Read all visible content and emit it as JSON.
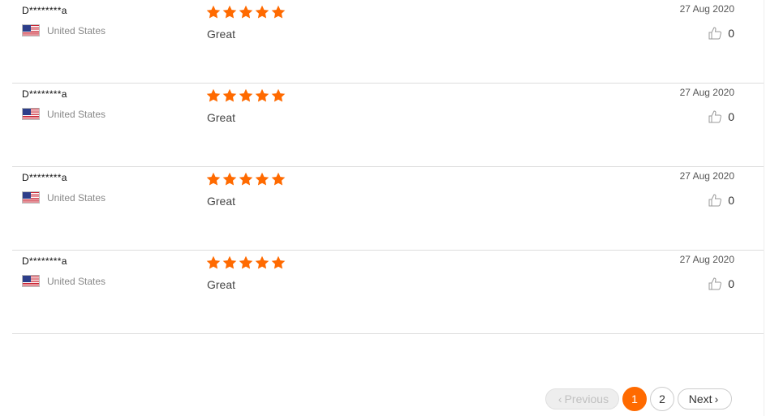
{
  "reviews": [
    {
      "user": "D********a",
      "country": "United States",
      "rating": 5,
      "comment": "Great",
      "date": "27 Aug 2020",
      "helpful_count": "0"
    },
    {
      "user": "D********a",
      "country": "United States",
      "rating": 5,
      "comment": "Great",
      "date": "27 Aug 2020",
      "helpful_count": "0"
    },
    {
      "user": "D********a",
      "country": "United States",
      "rating": 5,
      "comment": "Great",
      "date": "27 Aug 2020",
      "helpful_count": "0"
    },
    {
      "user": "D********a",
      "country": "United States",
      "rating": 5,
      "comment": "Great",
      "date": "27 Aug 2020",
      "helpful_count": "0"
    }
  ],
  "pagination": {
    "previous_label": "Previous",
    "pages": [
      "1",
      "2"
    ],
    "active_page": "1",
    "next_label": "Next"
  },
  "colors": {
    "star": "#ff6a00",
    "active_page": "#ff6a00",
    "divider": "#dddddd"
  },
  "icons": {
    "star": "star-icon",
    "flag": "us-flag-icon",
    "helpful": "thumbs-up-icon"
  }
}
